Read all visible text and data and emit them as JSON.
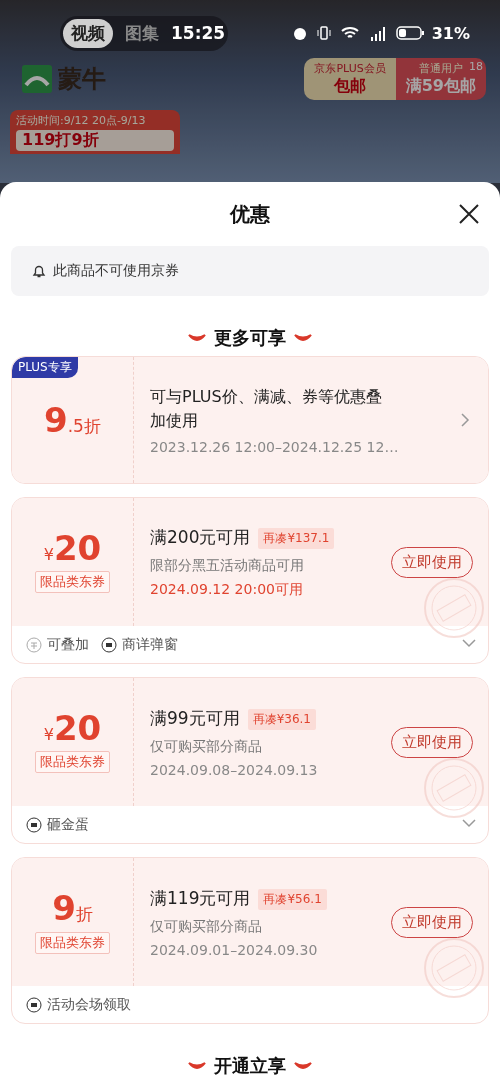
{
  "status_bar": {
    "tabs": [
      {
        "label": "视频",
        "selected": true
      },
      {
        "label": "图集",
        "selected": false
      }
    ],
    "time": "15:25",
    "battery": "31%"
  },
  "background": {
    "brand": "蒙牛",
    "shipping": [
      {
        "label": "京东PLUS会员",
        "value": "包邮",
        "kind": "plus"
      },
      {
        "label": "普通用户",
        "value": "满59包邮",
        "kind": "normal"
      }
    ],
    "badge": "18",
    "promo": {
      "time": "活动时间:9/12 20点-9/13",
      "title": "119打9折"
    }
  },
  "sheet": {
    "title": "优惠",
    "notice": "此商品不可使用京券"
  },
  "sections": [
    {
      "title": "更多可享",
      "offers": [
        {
          "kind": "plus",
          "tag": "PLUS专享",
          "amount": {
            "number": "9",
            "suffix": ".5折"
          },
          "title": "可与PLUS价、满减、券等优惠叠加使用",
          "date": "2023.12.26 12:00–2024.12.25 12…",
          "date_highlight": false
        },
        {
          "kind": "coupon",
          "amount": {
            "prefix": "¥",
            "number": "20"
          },
          "category": "限品类东券",
          "title": "满200元可用",
          "gap": "再凑¥137.1",
          "scope": "限部分黑五活动商品可用",
          "date": "2024.09.12 20:00可用",
          "date_highlight": true,
          "button": "立即使用",
          "claimed": true,
          "expandable": true,
          "features": [
            {
              "kind": "stack",
              "label": "可叠加"
            },
            {
              "kind": "popup",
              "label": "商详弹窗"
            }
          ]
        },
        {
          "kind": "coupon",
          "amount": {
            "prefix": "¥",
            "number": "20"
          },
          "category": "限品类东券",
          "title": "满99元可用",
          "gap": "再凑¥36.1",
          "scope": "仅可购买部分商品",
          "date": "2024.09.08–2024.09.13",
          "date_highlight": false,
          "button": "立即使用",
          "claimed": true,
          "expandable": true,
          "features": [
            {
              "kind": "popup",
              "label": "砸金蛋"
            }
          ]
        },
        {
          "kind": "coupon",
          "amount": {
            "number": "9",
            "suffix": "折"
          },
          "category": "限品类东券",
          "title": "满119元可用",
          "gap": "再凑¥56.1",
          "scope": "仅可购买部分商品",
          "date": "2024.09.01–2024.09.30",
          "date_highlight": false,
          "button": "立即使用",
          "claimed": true,
          "expandable": false,
          "features": [
            {
              "kind": "popup",
              "label": "活动会场领取"
            }
          ]
        }
      ]
    },
    {
      "title": "开通立享"
    }
  ]
}
